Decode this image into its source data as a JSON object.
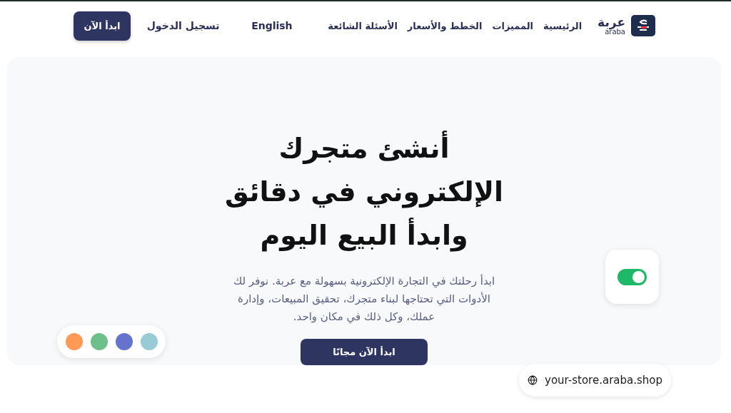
{
  "header": {
    "logo": {
      "name": "عربة",
      "latin": "araba"
    },
    "nav": [
      {
        "label": "الرئيسية"
      },
      {
        "label": "المميزات"
      },
      {
        "label": "الخطط والأسعار"
      },
      {
        "label": "الأسئلة الشائعة"
      }
    ],
    "language": "English",
    "login": "تسجيل الدخول",
    "cta": "ابدأ الآن"
  },
  "hero": {
    "title": "أنشئ متجرك الإلكتروني في دقائق وابدأ البيع اليوم",
    "description": "ابدأ رحلتك في التجارة الإلكترونية بسهولة مع عربة. نوفر لك الأدوات التي تحتاجها لبناء متجرك، تحقيق المبيعات، وإدارة عملك، وكل ذلك في مكان واحد.",
    "cta": "ابدأ الآن مجانًا",
    "toggle": {
      "on": true
    },
    "swatches": [
      {
        "color": "#fe9a55"
      },
      {
        "color": "#6fbf8a"
      },
      {
        "color": "#6673cc"
      },
      {
        "color": "#98cbd4"
      }
    ],
    "domain": "your-store.araba.shop"
  }
}
